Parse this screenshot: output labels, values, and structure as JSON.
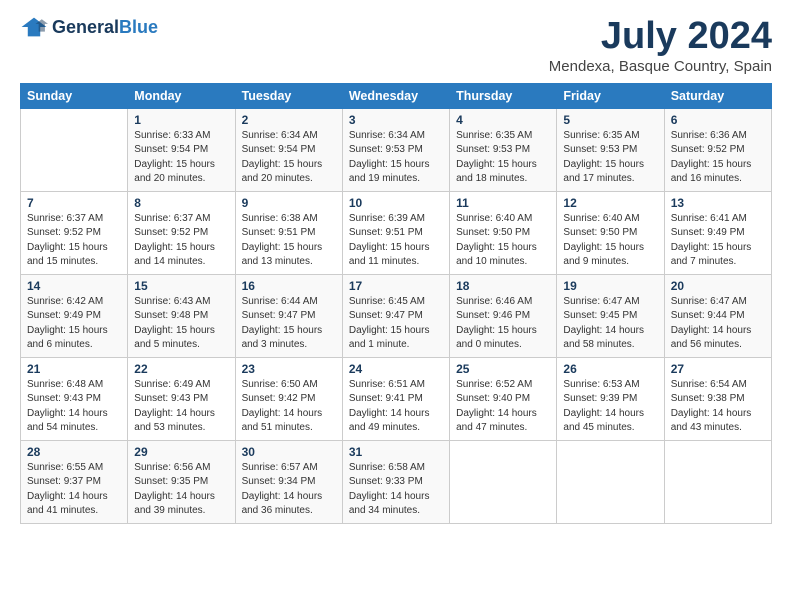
{
  "logo": {
    "general": "General",
    "blue": "Blue"
  },
  "title": "July 2024",
  "location": "Mendexa, Basque Country, Spain",
  "header_days": [
    "Sunday",
    "Monday",
    "Tuesday",
    "Wednesday",
    "Thursday",
    "Friday",
    "Saturday"
  ],
  "weeks": [
    [
      {
        "day": "",
        "info": ""
      },
      {
        "day": "1",
        "info": "Sunrise: 6:33 AM\nSunset: 9:54 PM\nDaylight: 15 hours\nand 20 minutes."
      },
      {
        "day": "2",
        "info": "Sunrise: 6:34 AM\nSunset: 9:54 PM\nDaylight: 15 hours\nand 20 minutes."
      },
      {
        "day": "3",
        "info": "Sunrise: 6:34 AM\nSunset: 9:53 PM\nDaylight: 15 hours\nand 19 minutes."
      },
      {
        "day": "4",
        "info": "Sunrise: 6:35 AM\nSunset: 9:53 PM\nDaylight: 15 hours\nand 18 minutes."
      },
      {
        "day": "5",
        "info": "Sunrise: 6:35 AM\nSunset: 9:53 PM\nDaylight: 15 hours\nand 17 minutes."
      },
      {
        "day": "6",
        "info": "Sunrise: 6:36 AM\nSunset: 9:52 PM\nDaylight: 15 hours\nand 16 minutes."
      }
    ],
    [
      {
        "day": "7",
        "info": "Sunrise: 6:37 AM\nSunset: 9:52 PM\nDaylight: 15 hours\nand 15 minutes."
      },
      {
        "day": "8",
        "info": "Sunrise: 6:37 AM\nSunset: 9:52 PM\nDaylight: 15 hours\nand 14 minutes."
      },
      {
        "day": "9",
        "info": "Sunrise: 6:38 AM\nSunset: 9:51 PM\nDaylight: 15 hours\nand 13 minutes."
      },
      {
        "day": "10",
        "info": "Sunrise: 6:39 AM\nSunset: 9:51 PM\nDaylight: 15 hours\nand 11 minutes."
      },
      {
        "day": "11",
        "info": "Sunrise: 6:40 AM\nSunset: 9:50 PM\nDaylight: 15 hours\nand 10 minutes."
      },
      {
        "day": "12",
        "info": "Sunrise: 6:40 AM\nSunset: 9:50 PM\nDaylight: 15 hours\nand 9 minutes."
      },
      {
        "day": "13",
        "info": "Sunrise: 6:41 AM\nSunset: 9:49 PM\nDaylight: 15 hours\nand 7 minutes."
      }
    ],
    [
      {
        "day": "14",
        "info": "Sunrise: 6:42 AM\nSunset: 9:49 PM\nDaylight: 15 hours\nand 6 minutes."
      },
      {
        "day": "15",
        "info": "Sunrise: 6:43 AM\nSunset: 9:48 PM\nDaylight: 15 hours\nand 5 minutes."
      },
      {
        "day": "16",
        "info": "Sunrise: 6:44 AM\nSunset: 9:47 PM\nDaylight: 15 hours\nand 3 minutes."
      },
      {
        "day": "17",
        "info": "Sunrise: 6:45 AM\nSunset: 9:47 PM\nDaylight: 15 hours\nand 1 minute."
      },
      {
        "day": "18",
        "info": "Sunrise: 6:46 AM\nSunset: 9:46 PM\nDaylight: 15 hours\nand 0 minutes."
      },
      {
        "day": "19",
        "info": "Sunrise: 6:47 AM\nSunset: 9:45 PM\nDaylight: 14 hours\nand 58 minutes."
      },
      {
        "day": "20",
        "info": "Sunrise: 6:47 AM\nSunset: 9:44 PM\nDaylight: 14 hours\nand 56 minutes."
      }
    ],
    [
      {
        "day": "21",
        "info": "Sunrise: 6:48 AM\nSunset: 9:43 PM\nDaylight: 14 hours\nand 54 minutes."
      },
      {
        "day": "22",
        "info": "Sunrise: 6:49 AM\nSunset: 9:43 PM\nDaylight: 14 hours\nand 53 minutes."
      },
      {
        "day": "23",
        "info": "Sunrise: 6:50 AM\nSunset: 9:42 PM\nDaylight: 14 hours\nand 51 minutes."
      },
      {
        "day": "24",
        "info": "Sunrise: 6:51 AM\nSunset: 9:41 PM\nDaylight: 14 hours\nand 49 minutes."
      },
      {
        "day": "25",
        "info": "Sunrise: 6:52 AM\nSunset: 9:40 PM\nDaylight: 14 hours\nand 47 minutes."
      },
      {
        "day": "26",
        "info": "Sunrise: 6:53 AM\nSunset: 9:39 PM\nDaylight: 14 hours\nand 45 minutes."
      },
      {
        "day": "27",
        "info": "Sunrise: 6:54 AM\nSunset: 9:38 PM\nDaylight: 14 hours\nand 43 minutes."
      }
    ],
    [
      {
        "day": "28",
        "info": "Sunrise: 6:55 AM\nSunset: 9:37 PM\nDaylight: 14 hours\nand 41 minutes."
      },
      {
        "day": "29",
        "info": "Sunrise: 6:56 AM\nSunset: 9:35 PM\nDaylight: 14 hours\nand 39 minutes."
      },
      {
        "day": "30",
        "info": "Sunrise: 6:57 AM\nSunset: 9:34 PM\nDaylight: 14 hours\nand 36 minutes."
      },
      {
        "day": "31",
        "info": "Sunrise: 6:58 AM\nSunset: 9:33 PM\nDaylight: 14 hours\nand 34 minutes."
      },
      {
        "day": "",
        "info": ""
      },
      {
        "day": "",
        "info": ""
      },
      {
        "day": "",
        "info": ""
      }
    ]
  ]
}
